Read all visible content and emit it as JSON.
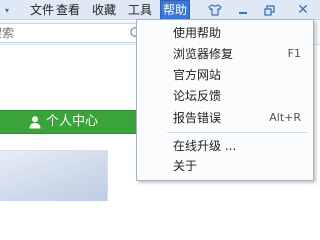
{
  "menubar": {
    "items": [
      {
        "label": "文件"
      },
      {
        "label": "查看"
      },
      {
        "label": "收藏"
      },
      {
        "label": "工具"
      },
      {
        "label": "帮助"
      }
    ],
    "active_index": 4
  },
  "window_controls": {
    "icons": [
      "shirt-icon",
      "minimize-icon",
      "restore-icon",
      "close-icon"
    ],
    "close_glyph": "✕"
  },
  "search": {
    "visible_text": "搜索",
    "icon": "search-icon"
  },
  "content": {
    "user_center_label": "个人中心",
    "user_center_icon": "user-icon"
  },
  "help_menu": {
    "items": [
      {
        "label": "使用帮助",
        "shortcut": ""
      },
      {
        "label": "浏览器修复",
        "shortcut": "F1"
      },
      {
        "label": "官方网站",
        "shortcut": ""
      },
      {
        "label": "论坛反馈",
        "shortcut": ""
      },
      {
        "label": "报告错误",
        "shortcut": "Alt+R"
      },
      {
        "label": "在线升级 ...",
        "shortcut": ""
      },
      {
        "label": "关于",
        "shortcut": ""
      }
    ]
  },
  "colors": {
    "menubar_bg": "#dfe9f6",
    "menu_active_bg": "#3b78d6",
    "accent_icon": "#3b73b9",
    "green_bar": "#3aa33a",
    "dropdown_bg": "#fbfcfd"
  }
}
